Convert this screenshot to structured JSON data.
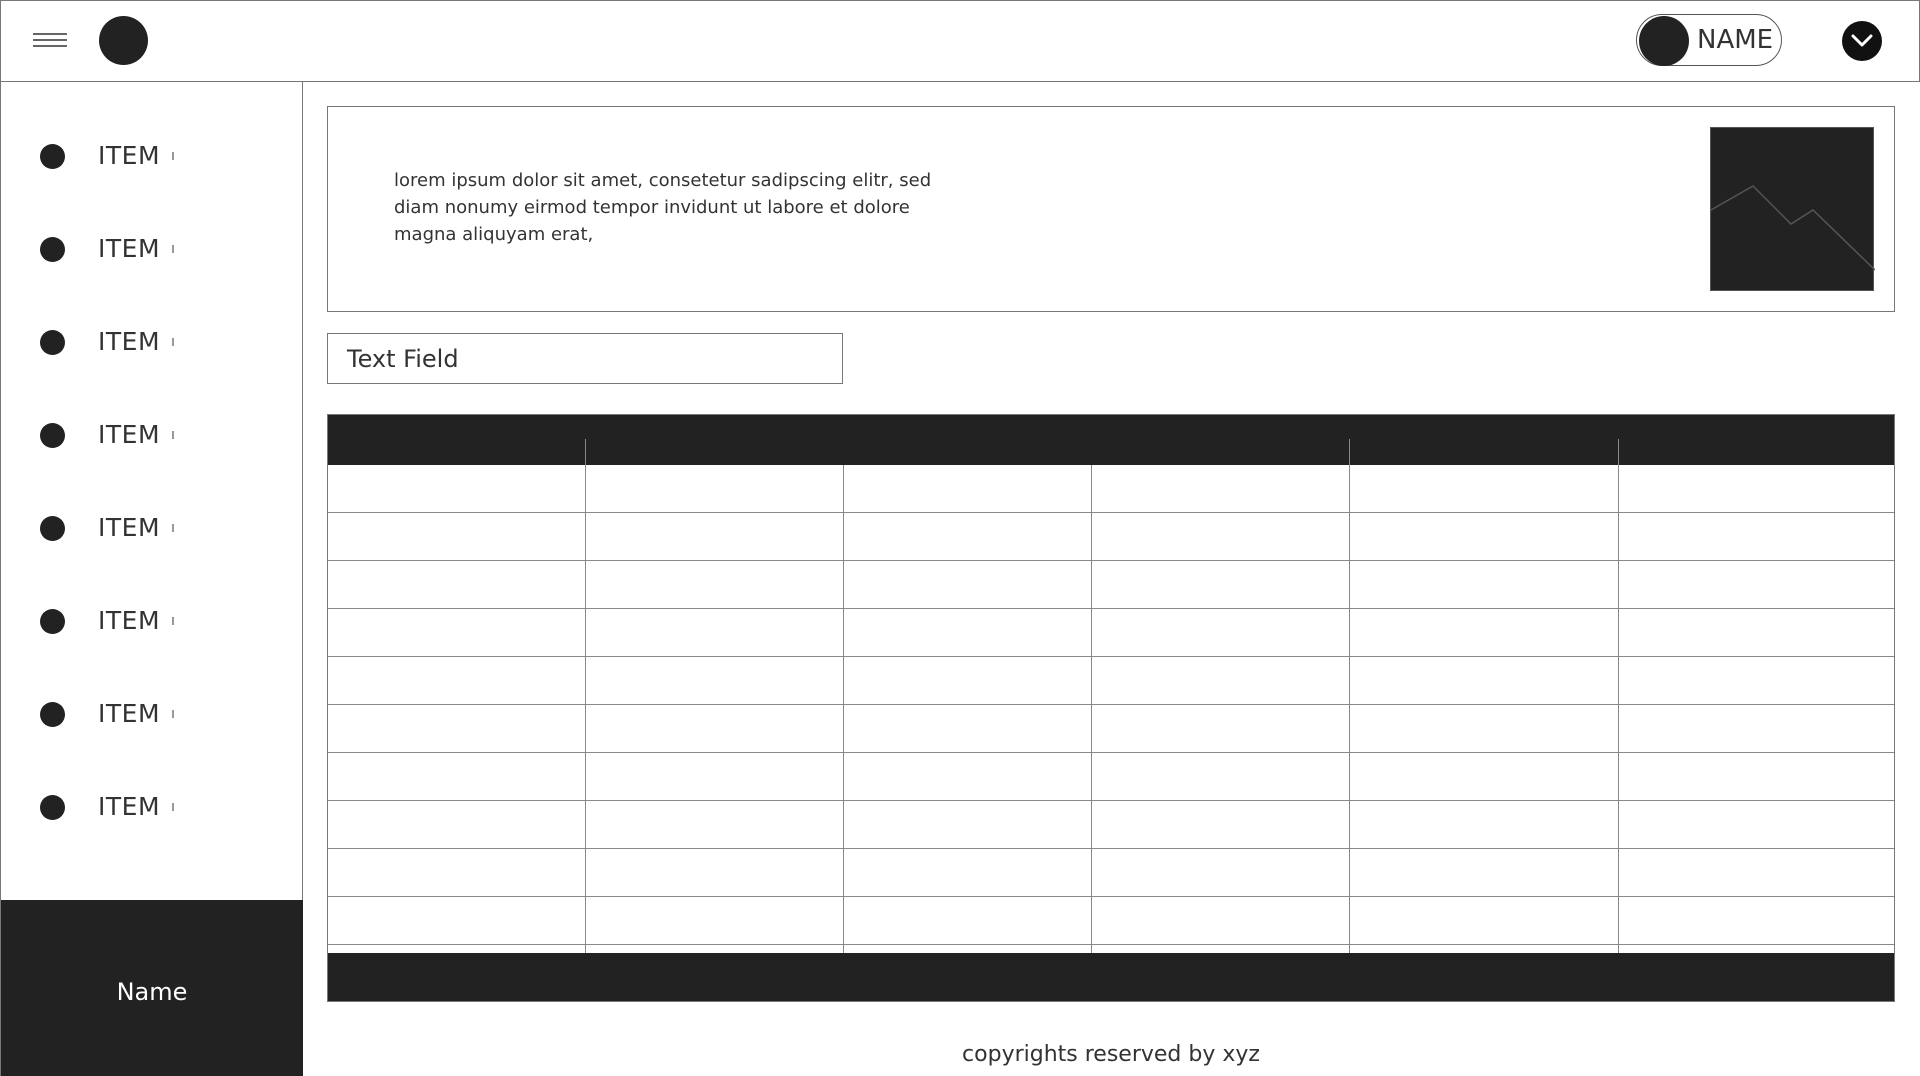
{
  "header": {
    "user_name": "NAME"
  },
  "sidebar": {
    "items": [
      {
        "label": "ITEM"
      },
      {
        "label": "ITEM"
      },
      {
        "label": "ITEM"
      },
      {
        "label": "ITEM"
      },
      {
        "label": "ITEM"
      },
      {
        "label": "ITEM"
      },
      {
        "label": "ITEM"
      },
      {
        "label": "ITEM"
      }
    ],
    "footer_name": "Name"
  },
  "card": {
    "description": "lorem ipsum dolor sit amet, consetetur sadipscing elitr, sed diam nonumy eirmod tempor invidunt ut labore et dolore magna aliquyam erat,"
  },
  "text_field": {
    "placeholder": "Text Field"
  },
  "table": {
    "columns": 6,
    "body_rows": 10
  },
  "footer": {
    "copyright": "copyrights reserved by xyz"
  },
  "colors": {
    "dark": "#222222",
    "border": "#777777",
    "background": "#ffffff"
  },
  "icons": {
    "menu": "hamburger-icon",
    "logo": "logo-circle-icon",
    "dropdown": "chevron-down-icon",
    "image": "image-placeholder-icon"
  }
}
